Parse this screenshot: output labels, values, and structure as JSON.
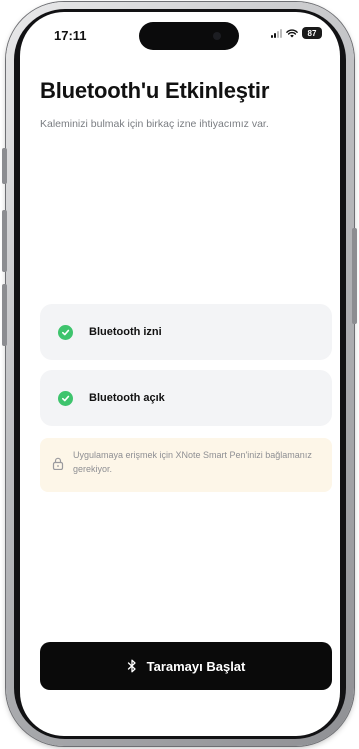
{
  "status_bar": {
    "time": "17:11",
    "battery": "87"
  },
  "page": {
    "title": "Bluetooth'u Etkinleştir",
    "subtitle": "Kaleminizi bulmak için birkaç izne ihtiyacımız var."
  },
  "permissions": [
    {
      "label": "Bluetooth izni",
      "icon": "check-circle-icon",
      "status": "granted"
    },
    {
      "label": "Bluetooth açık",
      "icon": "check-circle-icon",
      "status": "granted"
    }
  ],
  "notice": {
    "icon": "lock-icon",
    "text": "Uygulamaya erişmek için XNote Smart Pen'inizi bağlamanız gerekiyor."
  },
  "cta": {
    "icon": "bluetooth-icon",
    "label": "Taramayı Başlat"
  },
  "colors": {
    "accent_green": "#3ec46d",
    "card_bg": "#f3f4f6",
    "notice_bg": "#fdf6e8",
    "button_bg": "#0a0a0a"
  }
}
